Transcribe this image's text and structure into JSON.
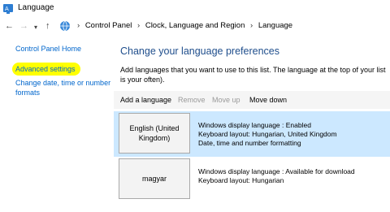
{
  "window": {
    "title": "Language"
  },
  "address": {
    "crumbs": [
      "Control Panel",
      "Clock, Language and Region",
      "Language"
    ]
  },
  "sidebar": {
    "home": "Control Panel Home",
    "advanced": "Advanced settings",
    "date_time": "Change date, time or number formats"
  },
  "main": {
    "heading": "Change your language preferences",
    "description": "Add languages that you want to use to this list. The language at the top of your list is your often)."
  },
  "toolbar": {
    "add": "Add a language",
    "remove": "Remove",
    "move_up": "Move up",
    "move_down": "Move down"
  },
  "languages": [
    {
      "name": "English (United Kingdom)",
      "lines": [
        "Windows display language : Enabled",
        "Keyboard layout: Hungarian, United Kingdom",
        "Date, time and number formatting"
      ]
    },
    {
      "name": "magyar",
      "lines": [
        "Windows display language : Available for download",
        "Keyboard layout: Hungarian"
      ]
    }
  ],
  "colors": {
    "selected_row": "#cce8ff",
    "link": "#0066cc",
    "heading": "#1f4e8c",
    "highlight": "#ffff00"
  }
}
